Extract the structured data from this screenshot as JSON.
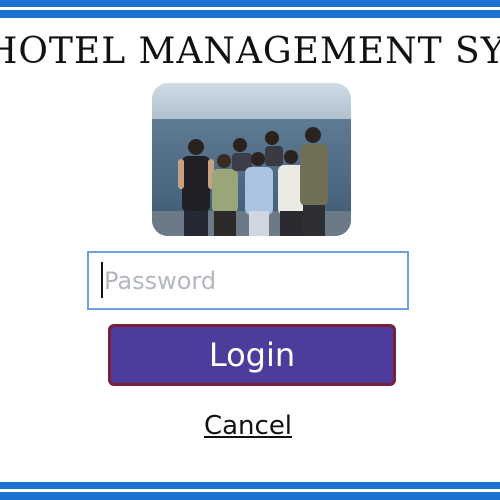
{
  "app": {
    "title": "HOTEL MANAGEMENT SYSTEM"
  },
  "photo": {
    "description_icon": "group-photo"
  },
  "password": {
    "value": "",
    "placeholder": "Password"
  },
  "buttons": {
    "login_label": "Login",
    "cancel_label": "Cancel"
  },
  "colors": {
    "band": "#1a73d1",
    "login_bg": "#4e3c9c",
    "login_border": "#7a1e3a",
    "input_border": "#6f9fe8"
  }
}
